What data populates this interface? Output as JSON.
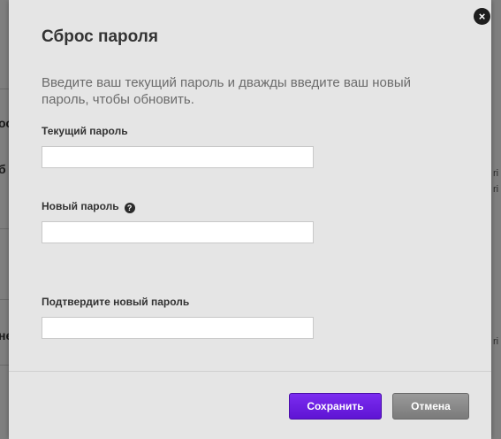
{
  "background": {
    "left_fragments": [
      "ос",
      "б",
      "не"
    ],
    "right_fragments": [
      "ri",
      "ri",
      "ri"
    ]
  },
  "dialog": {
    "close_glyph": "×",
    "title": "Сброс пароля",
    "intro": "Введите ваш текущий пароль и дважды введите ваш новый пароль, чтобы обновить.",
    "fields": [
      {
        "label": "Текущий пароль",
        "value": "",
        "placeholder": ""
      },
      {
        "label": "Новый пароль",
        "value": "",
        "placeholder": "",
        "help_icon": "?"
      },
      {
        "label": "Подтвердите новый пароль",
        "value": "",
        "placeholder": ""
      }
    ],
    "buttons": {
      "save": "Сохранить",
      "cancel": "Отмена"
    }
  },
  "colors": {
    "accent": "#6a1fe0",
    "cancel": "#8a8a8a",
    "dialog_bg": "#e5e5e5",
    "overlay": "#7f7f7f"
  },
  "icons": {
    "close": "close-icon",
    "help": "help-icon"
  }
}
